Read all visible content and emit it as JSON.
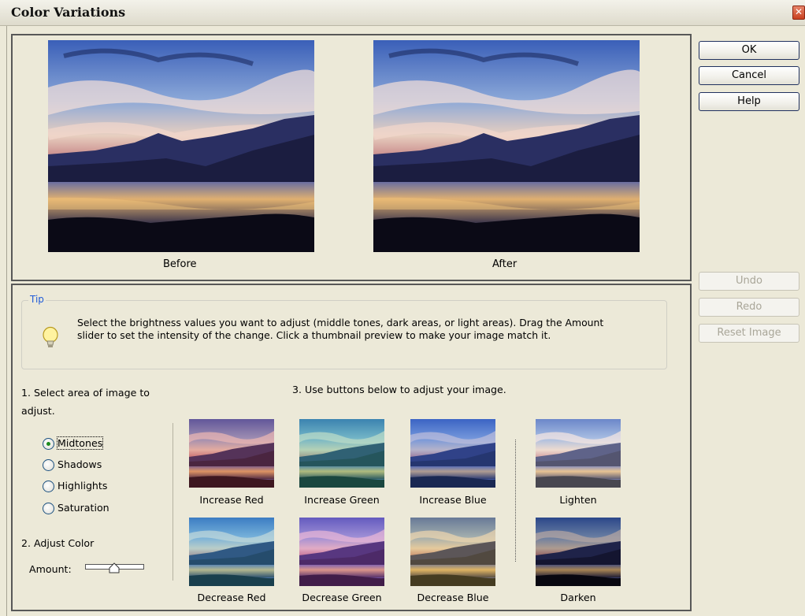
{
  "window": {
    "title": "Color Variations",
    "close_glyph": "✕"
  },
  "preview": {
    "before_label": "Before",
    "after_label": "After"
  },
  "buttons": {
    "ok": "OK",
    "cancel": "Cancel",
    "help": "Help",
    "undo": "Undo",
    "redo": "Redo",
    "reset": "Reset Image"
  },
  "tip": {
    "legend": "Tip",
    "icon": "lightbulb-icon",
    "text": "Select the brightness values you want to adjust (middle tones, dark areas, or light areas). Drag the Amount slider to set the intensity of the change. Click a thumbnail preview to make your image match it."
  },
  "step1": {
    "label": "1. Select area of image to adjust.",
    "options": [
      "Midtones",
      "Shadows",
      "Highlights",
      "Saturation"
    ],
    "selected": "Midtones"
  },
  "step2": {
    "label": "2. Adjust Color",
    "amount_label": "Amount:",
    "amount_value": 0.5
  },
  "step3": {
    "label": "3. Use buttons below to adjust your image.",
    "thumbs": [
      {
        "label": "Increase Red",
        "tint": "#d84040"
      },
      {
        "label": "Increase Green",
        "tint": "#3fd8a0"
      },
      {
        "label": "Increase Blue",
        "tint": "#3f6fe0"
      },
      {
        "label": "Lighten",
        "tint": "#ffffff"
      },
      {
        "label": "Decrease Red",
        "tint": "#40c8e0"
      },
      {
        "label": "Decrease Green",
        "tint": "#d050d0"
      },
      {
        "label": "Decrease Blue",
        "tint": "#e0c040"
      },
      {
        "label": "Darken",
        "tint": "#000000"
      }
    ]
  },
  "colors": {
    "accent": "#1f5bd8",
    "button_border": "#20315f",
    "panel_border": "#585858"
  }
}
